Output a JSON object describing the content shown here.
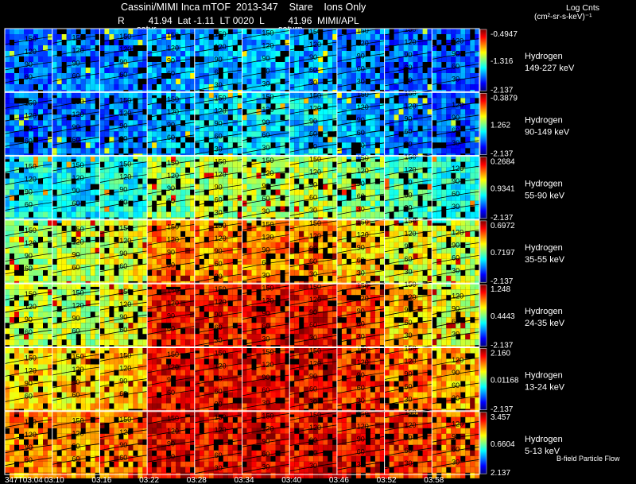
{
  "header": {
    "title": "Cassini/MIMI Inca mTOF  2013-347    Stare    Ions Only",
    "subline": "R         41.94  Lat -1.11  LT 0020  L         41.96  MIMI/APL",
    "saturn_labels": [
      "satur",
      "saturn"
    ],
    "units_line1": "Log Cnts",
    "units_line2": "(cm²-sr-s-keV)⁻¹",
    "footer_note": "B-field Particle Flow"
  },
  "chart_data": {
    "type": "heatmap",
    "time_labels": [
      "347T03:04",
      "03:10",
      "03:16",
      "03:22",
      "03:28",
      "03:34",
      "03:40",
      "03:46",
      "03:52",
      "03:58"
    ],
    "pitch_angle_labels": [
      "150",
      "120",
      "90",
      "60",
      "30"
    ],
    "panels": [
      {
        "species": "Hydrogen",
        "energy": "149-227 keV",
        "cbar_max": "-0.4947",
        "cbar_mid": "-1.316",
        "cbar_min": "-2.137",
        "intensity": [
          0.22,
          0.25,
          0.24,
          0.28,
          0.3,
          0.3,
          0.28,
          0.24,
          0.22,
          0.22
        ]
      },
      {
        "species": "Hydrogen",
        "energy": "90-149 keV",
        "cbar_max": "-0.3879",
        "cbar_mid": "1.262",
        "cbar_min": "-2.137",
        "intensity": [
          0.22,
          0.24,
          0.25,
          0.3,
          0.34,
          0.35,
          0.34,
          0.28,
          0.25,
          0.22
        ]
      },
      {
        "species": "Hydrogen",
        "energy": "55-90 keV",
        "cbar_max": "0.2684",
        "cbar_mid": "0.9341",
        "cbar_min": "-2.137",
        "intensity": [
          0.38,
          0.36,
          0.4,
          0.52,
          0.55,
          0.56,
          0.55,
          0.5,
          0.44,
          0.4
        ]
      },
      {
        "species": "Hydrogen",
        "energy": "35-55 keV",
        "cbar_max": "0.6972",
        "cbar_mid": "0.7197",
        "cbar_min": "-2.137",
        "intensity": [
          0.55,
          0.56,
          0.6,
          0.76,
          0.74,
          0.74,
          0.72,
          0.66,
          0.6,
          0.56
        ]
      },
      {
        "species": "Hydrogen",
        "energy": "24-35 keV",
        "cbar_max": "1.248",
        "cbar_mid": "0.4443",
        "cbar_min": "-2.137",
        "intensity": [
          0.55,
          0.56,
          0.6,
          0.86,
          0.84,
          0.86,
          0.88,
          0.8,
          0.68,
          0.6
        ]
      },
      {
        "species": "Hydrogen",
        "energy": "13-24 keV",
        "cbar_max": "2.160",
        "cbar_mid": "0.01168",
        "cbar_min": "-2.137",
        "intensity": [
          0.66,
          0.66,
          0.68,
          0.88,
          0.86,
          0.88,
          0.88,
          0.84,
          0.76,
          0.7
        ]
      },
      {
        "species": "Hydrogen",
        "energy": "5-13 keV",
        "cbar_max": "3.457",
        "cbar_mid": "0.6604",
        "cbar_min": "2.137",
        "intensity": [
          0.74,
          0.74,
          0.76,
          0.9,
          0.88,
          0.9,
          0.88,
          0.86,
          0.82,
          0.76
        ]
      }
    ]
  }
}
